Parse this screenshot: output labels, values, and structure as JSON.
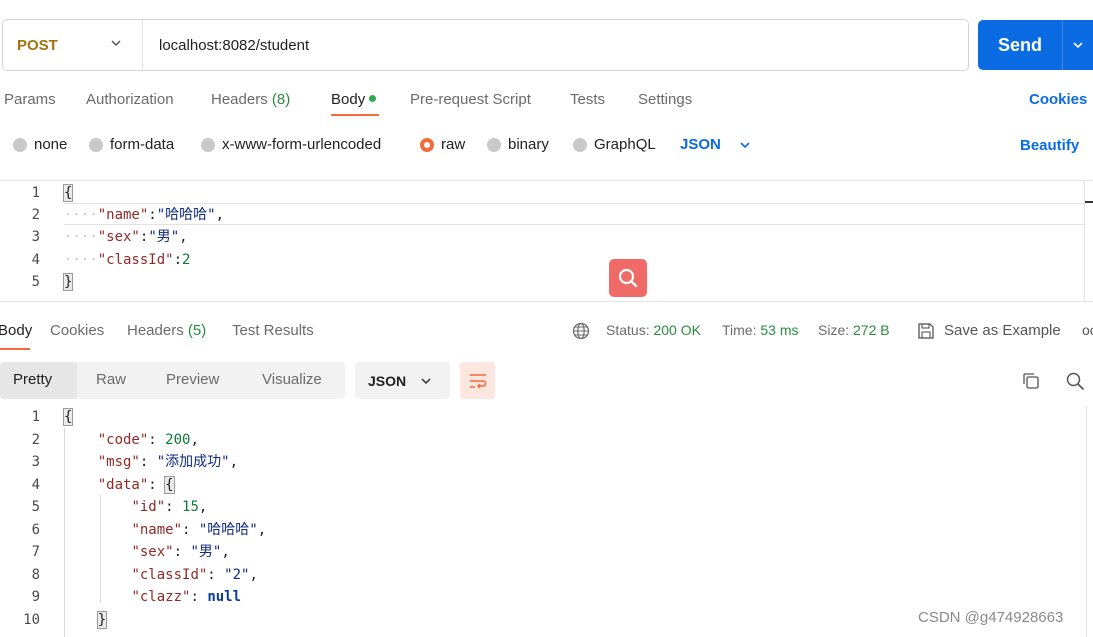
{
  "request": {
    "method": "POST",
    "url": "localhost:8082/student",
    "send_label": "Send"
  },
  "request_tabs": {
    "params": "Params",
    "authorization": "Authorization",
    "headers": "Headers",
    "headers_count": "(8)",
    "body": "Body",
    "prerequest": "Pre-request Script",
    "tests": "Tests",
    "settings": "Settings",
    "cookies": "Cookies"
  },
  "body_types": {
    "none": "none",
    "form_data": "form-data",
    "urlencoded": "x-www-form-urlencoded",
    "raw": "raw",
    "binary": "binary",
    "graphql": "GraphQL",
    "selected": "raw",
    "format": "JSON",
    "beautify": "Beautify"
  },
  "request_body": {
    "line_numbers": [
      "1",
      "2",
      "3",
      "4",
      "5"
    ],
    "open": "{",
    "close": "}",
    "fields": [
      {
        "key": "\"name\"",
        "value": "\"哈哈哈\"",
        "suffix": ","
      },
      {
        "key": "\"sex\"",
        "value": "\"男\"",
        "suffix": ","
      },
      {
        "key": "\"classId\"",
        "value": "2",
        "suffix": ""
      }
    ]
  },
  "response_tabs": {
    "body": "Body",
    "cookies": "Cookies",
    "headers": "Headers",
    "headers_count": "(5)",
    "test_results": "Test Results"
  },
  "status": {
    "status_label": "Status:",
    "status_value": "200 OK",
    "time_label": "Time:",
    "time_value": "53 ms",
    "size_label": "Size:",
    "size_value": "272 B",
    "save_example": "Save as Example"
  },
  "response_view": {
    "pretty": "Pretty",
    "raw": "Raw",
    "preview": "Preview",
    "visualize": "Visualize",
    "format": "JSON"
  },
  "response_body": {
    "line_numbers": [
      "1",
      "2",
      "3",
      "4",
      "5",
      "6",
      "7",
      "8",
      "9",
      "10"
    ],
    "open": "{",
    "code_key": "\"code\"",
    "code_value": "200",
    "msg_key": "\"msg\"",
    "msg_value": "\"添加成功\"",
    "data_key": "\"data\"",
    "data_open": "{",
    "data_close": "}",
    "data_fields": [
      {
        "key": "\"id\"",
        "value": "15",
        "type": "num",
        "suffix": ","
      },
      {
        "key": "\"name\"",
        "value": "\"哈哈哈\"",
        "type": "str",
        "suffix": ","
      },
      {
        "key": "\"sex\"",
        "value": "\"男\"",
        "type": "str",
        "suffix": ","
      },
      {
        "key": "\"classId\"",
        "value": "\"2\"",
        "type": "str",
        "suffix": ","
      },
      {
        "key": "\"clazz\"",
        "value": "null",
        "type": "kw",
        "suffix": ""
      }
    ]
  },
  "watermark": "CSDN @g474928663",
  "colors": {
    "accent_blue": "#0b6be3",
    "accent_orange": "#f26b3a",
    "method_color": "#a2740b",
    "success_green": "#2b8a3e"
  }
}
